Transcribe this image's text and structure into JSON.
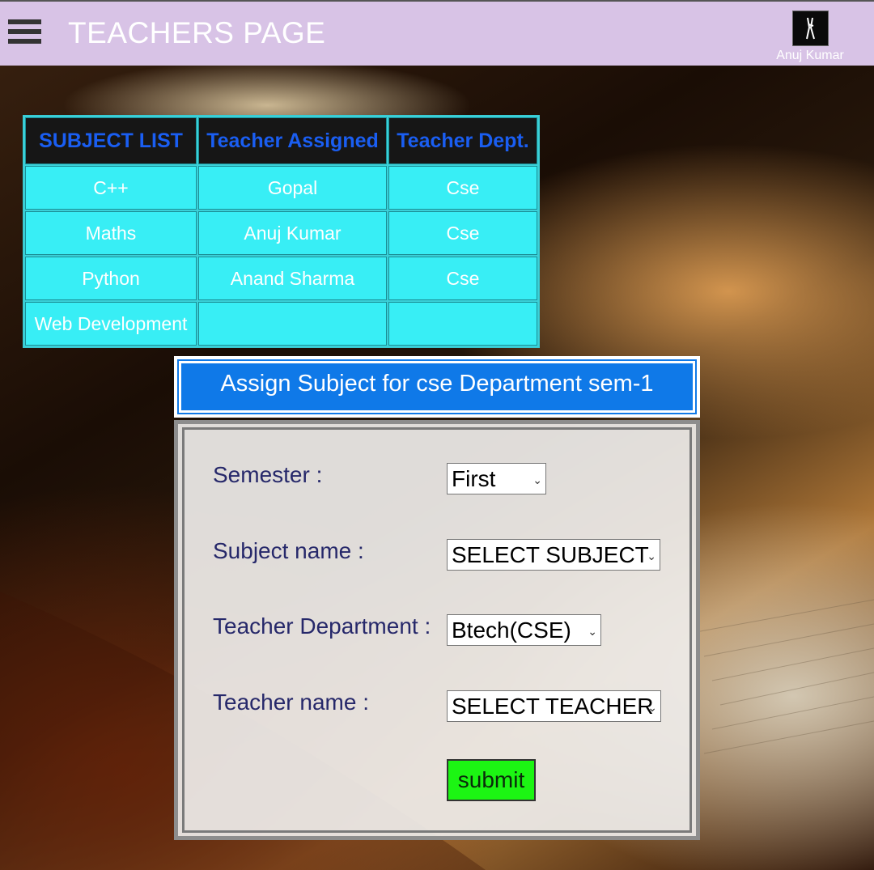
{
  "header": {
    "title": "TEACHERS PAGE",
    "user_name": "Anuj Kumar"
  },
  "subject_table": {
    "columns": [
      "SUBJECT LIST",
      "Teacher Assigned",
      "Teacher Dept."
    ],
    "rows": [
      [
        "C++",
        "Gopal",
        "Cse"
      ],
      [
        "Maths",
        "Anuj Kumar",
        "Cse"
      ],
      [
        "Python",
        "Anand Sharma",
        "Cse"
      ],
      [
        "Web Development",
        "",
        ""
      ]
    ]
  },
  "assign": {
    "heading": "Assign Subject for cse Department sem-1",
    "semester_label": "Semester :",
    "semester_value": "First",
    "subject_label": "Subject name :",
    "subject_value": "SELECT SUBJECT",
    "dept_label": "Teacher Department :",
    "dept_value": "Btech(CSE)",
    "teacher_label": "Teacher name :",
    "teacher_value": "SELECT TEACHER",
    "submit_label": "submit"
  },
  "colors": {
    "topbar": "#d8c3e6",
    "table_header_text": "#1a5ef2",
    "table_cell_bg": "#38eef5",
    "assign_header_bg": "#0f79e8",
    "submit_bg": "#1cf513",
    "label_text": "#26286a"
  }
}
